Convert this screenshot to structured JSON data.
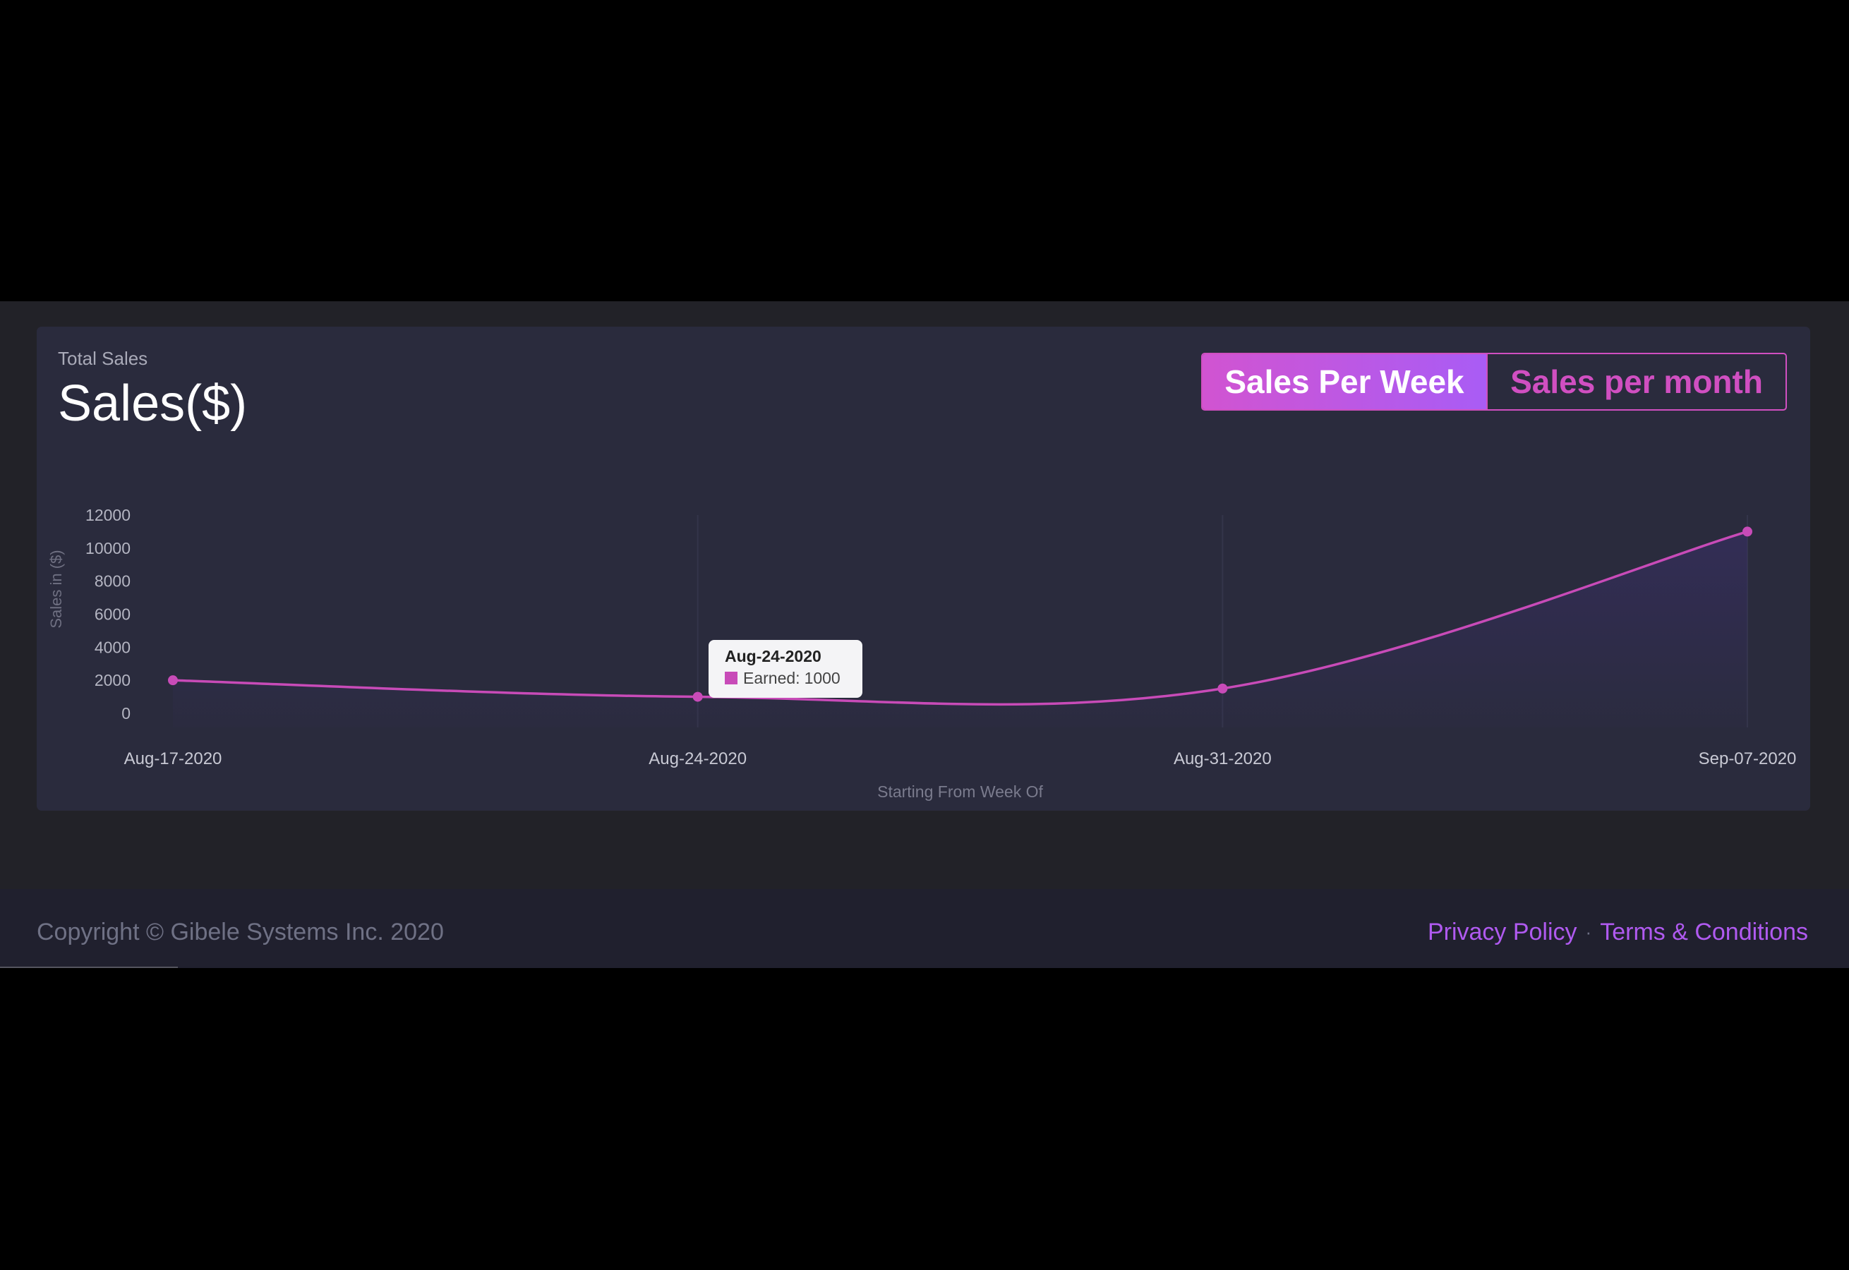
{
  "card": {
    "subtitle": "Total Sales",
    "title": "Sales($)"
  },
  "toggle": {
    "week_label": "Sales Per Week",
    "month_label": "Sales per month",
    "active": "week"
  },
  "tooltip": {
    "title": "Aug-24-2020",
    "series_prefix": "Earned:",
    "value": "1000"
  },
  "footer": {
    "copyright": "Copyright © Gibele Systems Inc. 2020",
    "privacy_label": "Privacy Policy",
    "separator": "·",
    "terms_label": "Terms & Conditions"
  },
  "colors": {
    "accent": "#c84bb8",
    "link": "#b05af0",
    "card_bg": "#2a2b3d"
  },
  "chart_data": {
    "type": "line",
    "title": "",
    "xlabel": "Starting From Week Of",
    "ylabel": "Sales in ($)",
    "categories": [
      "Aug-17-2020",
      "Aug-24-2020",
      "Aug-31-2020",
      "Sep-07-2020"
    ],
    "series": [
      {
        "name": "Earned",
        "values": [
          2000,
          1000,
          1500,
          11000
        ]
      }
    ],
    "yticks": [
      12000,
      10000,
      8000,
      6000,
      4000,
      2000,
      0
    ],
    "ylim": [
      0,
      12000
    ],
    "grid": "vertical",
    "legend": "none",
    "smooth": true,
    "highlighted_category": "Aug-24-2020"
  }
}
